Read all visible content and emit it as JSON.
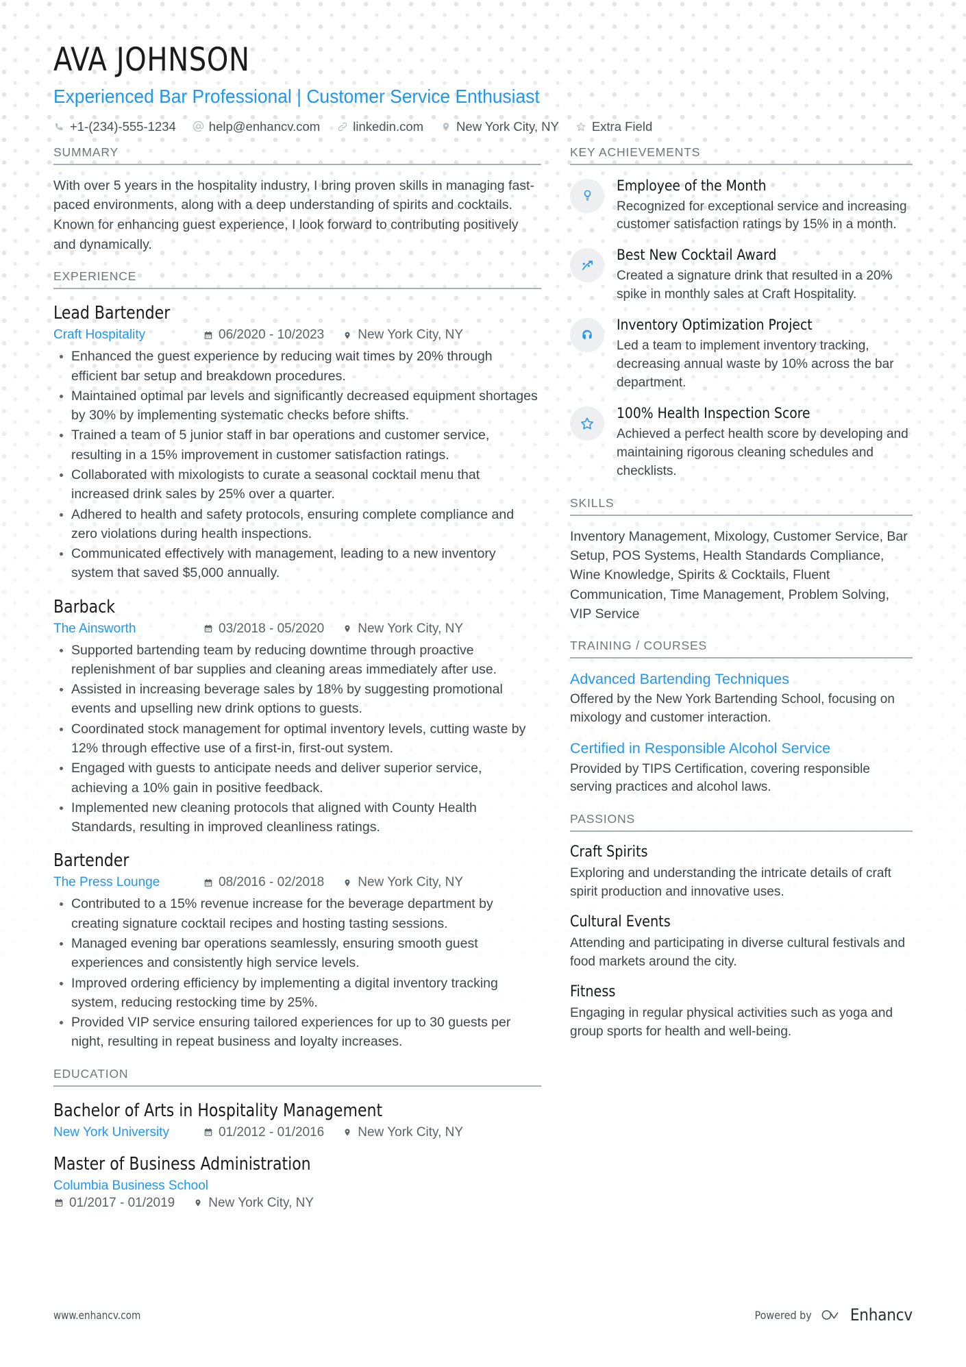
{
  "theme": {
    "accent": "#2196f3",
    "text": "#3e464c",
    "heading": "#6f767c",
    "rule": "#a8afb5",
    "badge_bg": "#eeeff0"
  },
  "header": {
    "name": "AVA JOHNSON",
    "headline": "Experienced Bar Professional | Customer Service Enthusiast",
    "contacts": [
      {
        "icon": "phone-icon",
        "text": "+1-(234)-555-1234"
      },
      {
        "icon": "at-sign-icon",
        "text": "help@enhancv.com"
      },
      {
        "icon": "link-icon",
        "text": "linkedin.com"
      },
      {
        "icon": "map-pin-icon",
        "text": "New York City, NY"
      },
      {
        "icon": "star-outline-icon",
        "text": "Extra Field"
      }
    ]
  },
  "left": {
    "summary": {
      "section_title": "SUMMARY",
      "text": "With over 5 years in the hospitality industry, I bring proven skills in managing fast-paced environments, along with a deep understanding of spirits and cocktails. Known for enhancing guest experience, I look forward to contributing positively and dynamically."
    },
    "experience": {
      "section_title": "EXPERIENCE",
      "entries": [
        {
          "title": "Lead Bartender",
          "org": "Craft Hospitality",
          "dates": "06/2020 - 10/2023",
          "location": "New York City, NY",
          "bullets": [
            "Enhanced the guest experience by reducing wait times by 20% through efficient bar setup and breakdown procedures.",
            "Maintained optimal par levels and significantly decreased equipment shortages by 30% by implementing systematic checks before shifts.",
            "Trained a team of 5 junior staff in bar operations and customer service, resulting in a 15% improvement in customer satisfaction ratings.",
            "Collaborated with mixologists to curate a seasonal cocktail menu that increased drink sales by 25% over a quarter.",
            "Adhered to health and safety protocols, ensuring complete compliance and zero violations during health inspections.",
            "Communicated effectively with management, leading to a new inventory system that saved $5,000 annually."
          ]
        },
        {
          "title": "Barback",
          "org": "The Ainsworth",
          "dates": "03/2018 - 05/2020",
          "location": "New York City, NY",
          "bullets": [
            "Supported bartending team by reducing downtime through proactive replenishment of bar supplies and cleaning areas immediately after use.",
            "Assisted in increasing beverage sales by 18% by suggesting promotional events and upselling new drink options to guests.",
            "Coordinated stock management for optimal inventory levels, cutting waste by 12% through effective use of a first-in, first-out system.",
            "Engaged with guests to anticipate needs and deliver superior service, achieving a 10% gain in positive feedback.",
            "Implemented new cleaning protocols that aligned with County Health Standards, resulting in improved cleanliness ratings."
          ]
        },
        {
          "title": "Bartender",
          "org": "The Press Lounge",
          "dates": "08/2016 - 02/2018",
          "location": "New York City, NY",
          "bullets": [
            "Contributed to a 15% revenue increase for the beverage department by creating signature cocktail recipes and hosting tasting sessions.",
            "Managed evening bar operations seamlessly, ensuring smooth guest experiences and consistently high service levels.",
            "Improved ordering efficiency by implementing a digital inventory tracking system, reducing restocking time by 25%.",
            "Provided VIP service ensuring tailored experiences for up to 30 guests per night, resulting in repeat business and loyalty increases."
          ]
        }
      ]
    },
    "education": {
      "section_title": "EDUCATION",
      "entries": [
        {
          "title": "Bachelor of Arts in Hospitality Management",
          "org": "New York University",
          "dates": "01/2012 - 01/2016",
          "location": "New York City, NY",
          "stacked": false
        },
        {
          "title": "Master of Business Administration",
          "org": "Columbia Business School",
          "dates": "01/2017 - 01/2019",
          "location": "New York City, NY",
          "stacked": true
        }
      ]
    }
  },
  "right": {
    "achievements": {
      "section_title": "KEY ACHIEVEMENTS",
      "items": [
        {
          "icon": "lightbulb-icon",
          "title": "Employee of the Month",
          "desc": "Recognized for exceptional service and increasing customer satisfaction ratings by 15% in a month."
        },
        {
          "icon": "trending-arrow-icon",
          "title": "Best New Cocktail Award",
          "desc": "Created a signature drink that resulted in a 20% spike in monthly sales at Craft Hospitality."
        },
        {
          "icon": "headphones-icon",
          "title": "Inventory Optimization Project",
          "desc": "Led a team to implement inventory tracking, decreasing annual waste by 10% across the bar department."
        },
        {
          "icon": "star-outline-icon",
          "title": "100% Health Inspection Score",
          "desc": "Achieved a perfect health score by developing and maintaining rigorous cleaning schedules and checklists."
        }
      ]
    },
    "skills": {
      "section_title": "SKILLS",
      "text": "Inventory Management, Mixology, Customer Service, Bar Setup, POS Systems, Health Standards Compliance, Wine Knowledge, Spirits & Cocktails, Fluent Communication, Time Management, Problem Solving, VIP Service"
    },
    "training": {
      "section_title": "TRAINING / COURSES",
      "items": [
        {
          "title": "Advanced Bartending Techniques",
          "desc": "Offered by the New York Bartending School, focusing on mixology and customer interaction."
        },
        {
          "title": "Certified in Responsible Alcohol Service",
          "desc": "Provided by TIPS Certification, covering responsible serving practices and alcohol laws."
        }
      ]
    },
    "passions": {
      "section_title": "PASSIONS",
      "items": [
        {
          "title": "Craft Spirits",
          "desc": "Exploring and understanding the intricate details of craft spirit production and innovative uses."
        },
        {
          "title": "Cultural Events",
          "desc": "Attending and participating in diverse cultural festivals and food markets around the city."
        },
        {
          "title": "Fitness",
          "desc": "Engaging in regular physical activities such as yoga and group sports for health and well-being."
        }
      ]
    }
  },
  "footer": {
    "url": "www.enhancv.com",
    "powered_by": "Powered by",
    "brand": "Enhancv"
  }
}
